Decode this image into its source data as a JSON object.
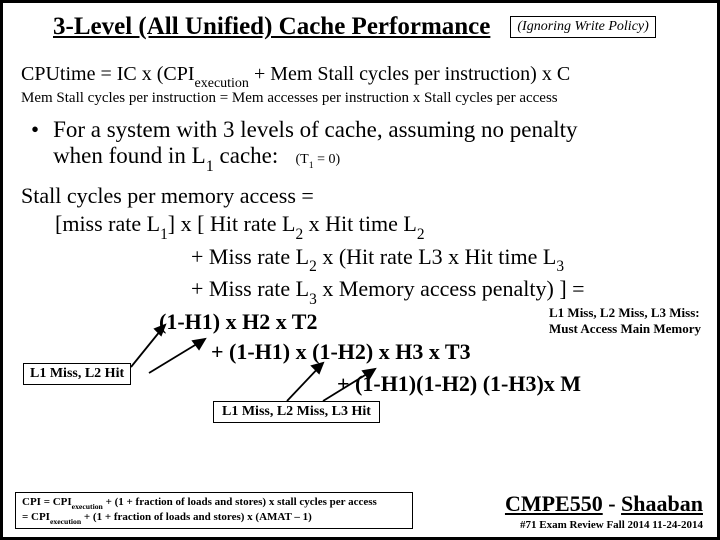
{
  "title": "3-Level (All Unified) Cache Performance",
  "ignore": "(Ignoring Write Policy)",
  "eq_main_a": "CPUtime  =  IC x   (CPI",
  "eq_main_sub1": "execution",
  "eq_main_b": "  +  Mem Stall  cycles per instruction)    x   C",
  "eq_sub": "Mem Stall cycles per instruction =  Mem accesses per instruction  x  Stall cycles per access",
  "bullet1a": "For a system with 3 levels of cache, assuming no penalty",
  "bullet1b_a": "when found in L",
  "bullet1b_b": " cache:",
  "t1note": "(T",
  "t1sub": "1",
  "t1rest": " = 0)",
  "stall1": "Stall cycles per memory access =",
  "stall2_a": "[miss rate L",
  "stall2_b": "] x  [ Hit rate L",
  "stall2_c": "  x Hit time L",
  "stall3_a": "+  Miss rate L",
  "stall3_b": " x  (Hit rate L3 x Hit time L",
  "stall4_a": "+  Miss rate L",
  "stall4_b": "  x  Memory access penalty) ]  =",
  "hf1": "(1-H1) x H2 x T2",
  "hf2": "+    (1-H1) x (1-H2) x H3 x T3",
  "hf3": "+     (1-H1)(1-H2) (1-H3)x M",
  "l1missbox": "L1 Miss,  L2  Hit",
  "l3note1": "L1 Miss,  L2 Miss, L3 Miss:",
  "l3note2": "Must Access Main Memory",
  "l1l2l3box": "L1 Miss, L2 Miss,  L3  Hit",
  "cpi1a": "CPI = CPI",
  "cpi1sub": "execution",
  "cpi1b": "  +  (1 + fraction of loads and stores) x stall cycles per access",
  "cpi2a": "   = CPI",
  "cpi2sub": "execution",
  "cpi2b": "  +  (1 + fraction of loads and stores) x (AMAT – 1)",
  "course_a": "CMPE550",
  "course_b": " - ",
  "course_c": "Shaaban",
  "examline": "#71   Exam  Review   Fall 2014   11-24-2014"
}
